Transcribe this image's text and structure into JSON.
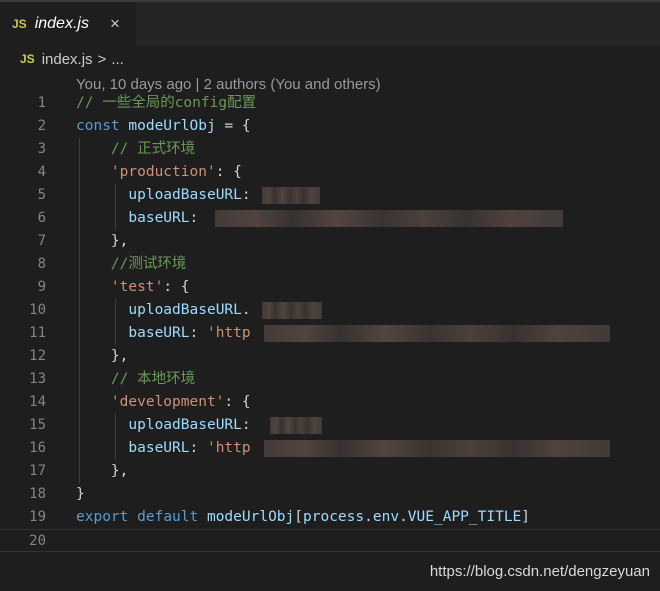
{
  "tab": {
    "badge": "JS",
    "filename": "index.js",
    "close": "×"
  },
  "breadcrumb": {
    "badge": "JS",
    "file": "index.js",
    "separator": ">",
    "more": "..."
  },
  "blame": "You, 10 days ago | 2 authors (You and others)",
  "lines": {
    "n": [
      "1",
      "2",
      "3",
      "4",
      "5",
      "6",
      "7",
      "8",
      "9",
      "10",
      "11",
      "12",
      "13",
      "14",
      "15",
      "16",
      "17",
      "18",
      "19",
      "20"
    ],
    "l1": "// 一些全局的config配置",
    "l2_kw": "const",
    "l2_var": "modeUrlObj",
    "l2_rest": " = {",
    "l3": "// 正式环境",
    "l4_key": "'production'",
    "l4_rest": ": {",
    "l5_key": "uploadBaseURL",
    "l5_rest": ":",
    "l6_key": "baseURL",
    "l6_rest": ":",
    "l7": "},",
    "l8": "//测试环境",
    "l9_key": "'test'",
    "l9_rest": ": {",
    "l10_key": "uploadBaseURL",
    "l10_rest": ".",
    "l11_key": "baseURL",
    "l11_rest": ": ",
    "l11_str": "'http",
    "l12": "},",
    "l13": "// 本地环境",
    "l14_key": "'development'",
    "l14_rest": ": {",
    "l15_key": "uploadBaseURL",
    "l15_rest": ":",
    "l16_key": "baseURL",
    "l16_rest": ": ",
    "l16_str": "'http",
    "l17": "},",
    "l18": "}",
    "l19_kw1": "export",
    "l19_kw2": "default",
    "l19_var": "modeUrlObj",
    "l19_rest1": "[",
    "l19_var2": "process",
    "l19_rest2": ".",
    "l19_var3": "env",
    "l19_rest3": ".",
    "l19_var4": "VUE_APP_TITLE",
    "l19_rest4": "]"
  },
  "watermark": "https://blog.csdn.net/dengzeyuan",
  "colors": {
    "background": "#1e1e1e",
    "keyword": "#569cd6",
    "variable": "#9cdcfe",
    "string": "#ce9178",
    "comment": "#6a9955",
    "lineNumber": "#858585"
  }
}
